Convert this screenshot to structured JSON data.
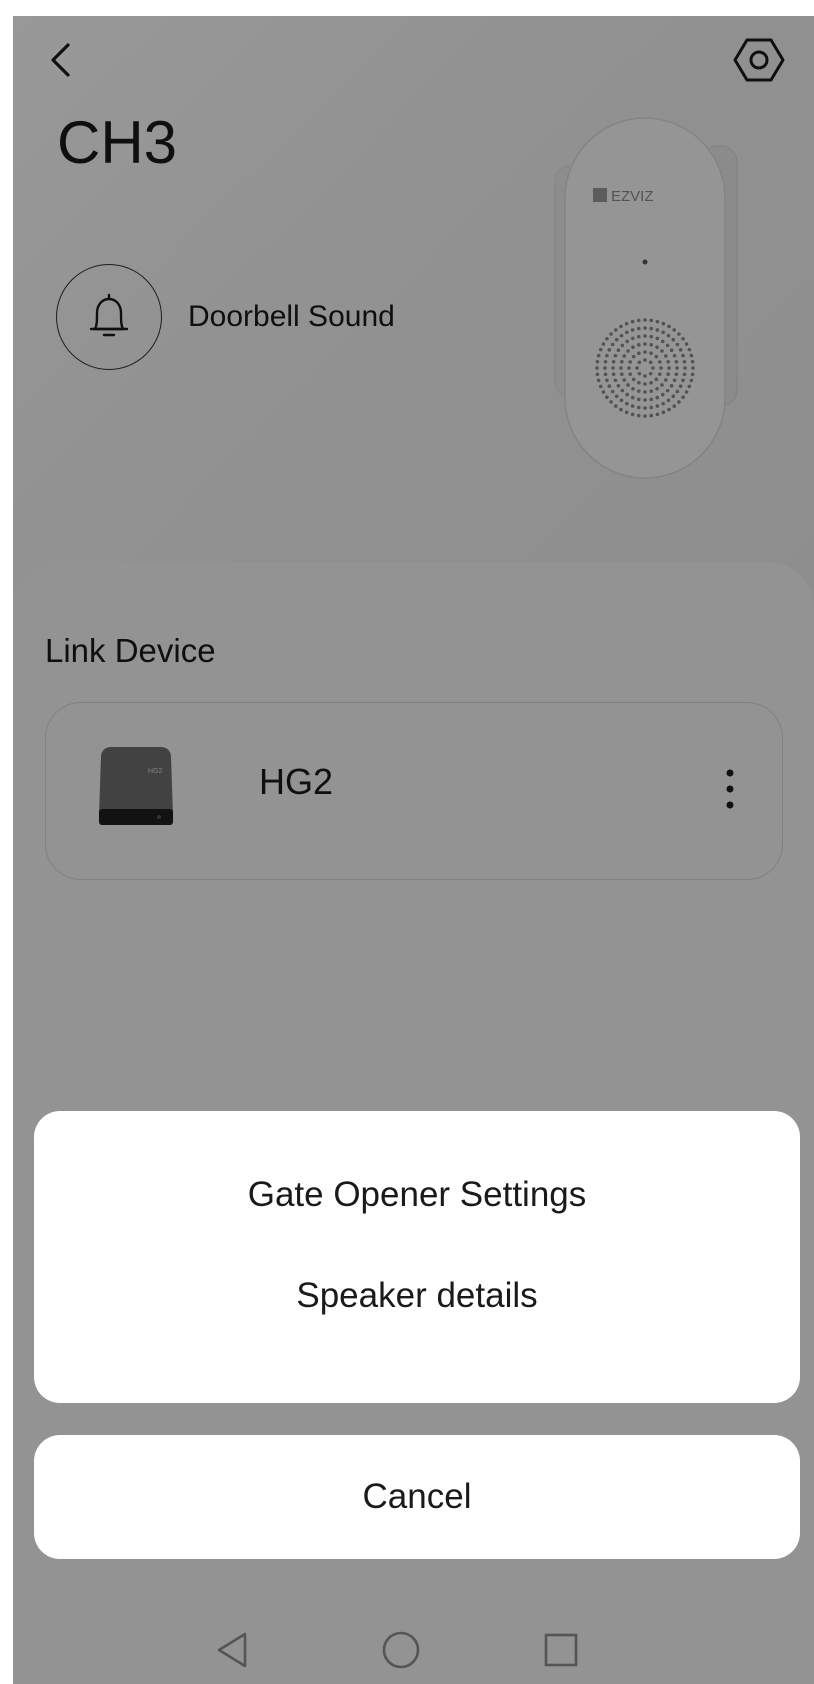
{
  "header": {
    "title": "CH3",
    "sound_label": "Doorbell Sound",
    "device_brand": "EZVIZ"
  },
  "icons": {
    "back": "chevron-left-icon",
    "settings": "hexagon-gear-icon",
    "bell": "bell-icon",
    "more": "more-vertical-icon"
  },
  "link_section": {
    "title": "Link Device",
    "devices": [
      {
        "name": "HG2",
        "image_text": "HG2"
      }
    ]
  },
  "action_sheet": {
    "items": [
      "Gate Opener Settings",
      "Speaker details"
    ],
    "cancel_label": "Cancel"
  },
  "colors": {
    "background": "#f2f2f2",
    "text": "#1a1a1a",
    "sheet": "#ffffff",
    "overlay": "rgba(0,0,0,0.4)"
  }
}
